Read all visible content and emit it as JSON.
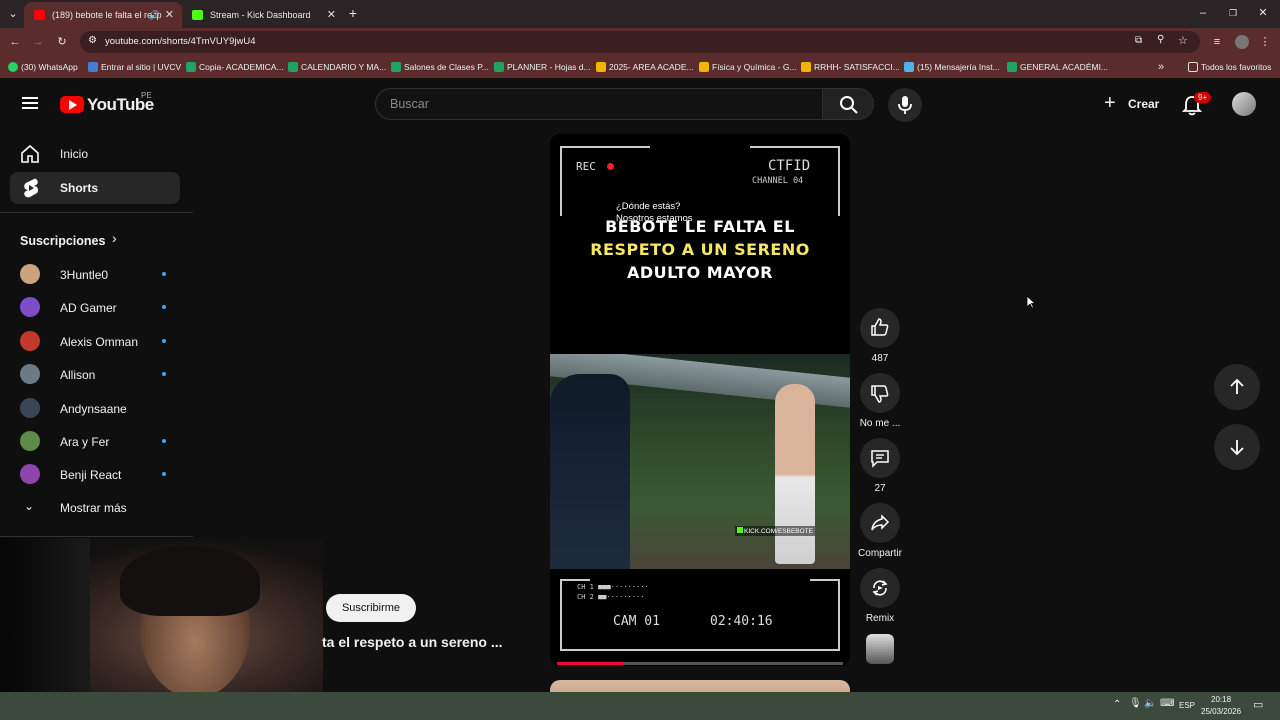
{
  "browser": {
    "tabs": [
      {
        "title": "(189) bebote le falta el resp"
      },
      {
        "title": "Stream - Kick Dashboard"
      }
    ],
    "url": "youtube.com/shorts/4TmVUY9jwU4",
    "bookmarks": [
      "(30) WhatsApp",
      "Entrar al sitio | UVCV",
      "Copia- ACADEMICA...",
      "CALENDARIO Y MA...",
      "Salones de Clases P...",
      "PLANNER - Hojas d...",
      "2025- AREA ACADE...",
      "Física y Química - G...",
      "RRHH- SATISFACCI...",
      "(15) Mensajería Inst...",
      "GENERAL ACADÉMI..."
    ],
    "all_favorites": "Todos los favoritos"
  },
  "youtube": {
    "logo_text": "YouTube",
    "region": "PE",
    "search_placeholder": "Buscar",
    "create_label": "Crear",
    "notif_badge": "9+",
    "nav": {
      "home": "Inicio",
      "shorts": "Shorts"
    },
    "subs_heading": "Suscripciones",
    "subs": [
      {
        "name": "3Huntle0",
        "color": "#c9a47e",
        "dot": true
      },
      {
        "name": "AD Gamer",
        "color": "#7d4cc9",
        "dot": true
      },
      {
        "name": "Alexis Omman",
        "color": "#c0392b",
        "dot": true
      },
      {
        "name": "Allison",
        "color": "#6b7b86",
        "dot": true
      },
      {
        "name": "Andynsaane",
        "color": "#3a4456",
        "dot": false
      },
      {
        "name": "Ara y Fer",
        "color": "#5e8a4a",
        "dot": true
      },
      {
        "name": "Benji React",
        "color": "#8e44ad",
        "dot": true
      }
    ],
    "show_more": "Mostrar más",
    "subscribe_button": "Suscribirme",
    "short_title_partial": "ta el respeto a un sereno ...",
    "video": {
      "rec": "REC",
      "ctfid": "CTFID",
      "channel": "CHANNEL 04",
      "question": "¿Dónde estás?",
      "answer": "Nosotros estamos",
      "caption_l1": "BEBOTE LE FALTA EL",
      "caption_l2": "RESPETO A UN SERENO",
      "caption_l3": "ADULTO MAYOR",
      "watermark": "KICK.COM/ESBEBOTE",
      "ch1": "CH 1",
      "ch2": "CH 2",
      "cam": "CAM 01",
      "time": "02:40:16"
    },
    "actions": {
      "likes": "487",
      "dislike": "No me ...",
      "comments": "27",
      "share": "Compartir",
      "remix": "Remix"
    }
  },
  "taskbar": {
    "lang": "ESP",
    "time": "20:18",
    "date": "25/03/2026"
  }
}
